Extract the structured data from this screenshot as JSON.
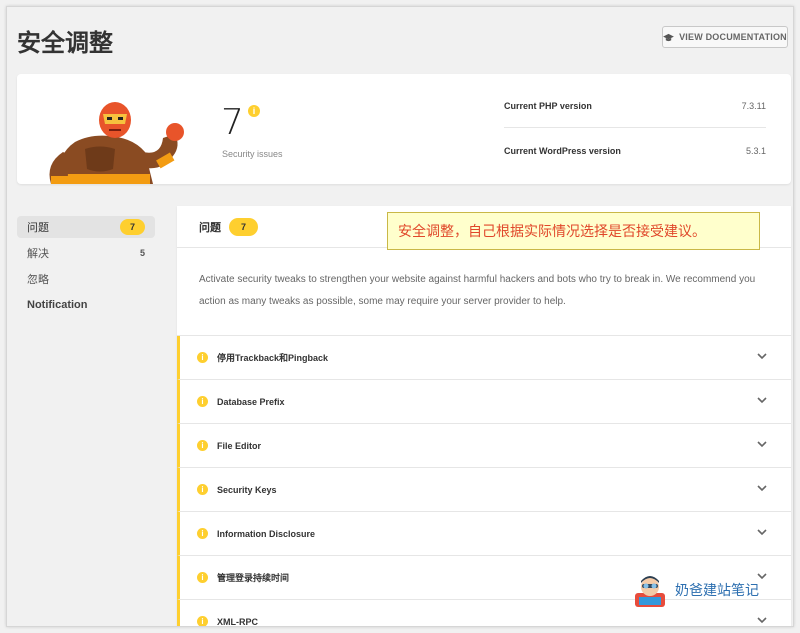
{
  "page": {
    "title": "安全调整",
    "doc_button": "VIEW DOCUMENTATION"
  },
  "summary": {
    "issue_count": "7",
    "issue_label": "Security issues",
    "php_label": "Current PHP version",
    "php_value": "7.3.11",
    "wp_label": "Current WordPress version",
    "wp_value": "5.3.1"
  },
  "sidenav": {
    "items": [
      {
        "label": "问题",
        "count": "7"
      },
      {
        "label": "解决",
        "count": "5"
      },
      {
        "label": "忽略",
        "count": ""
      },
      {
        "label": "Notification",
        "count": ""
      }
    ]
  },
  "panel": {
    "title": "问题",
    "count": "7",
    "description": "Activate security tweaks to strengthen your website against harmful hackers and bots who try to break in. We recommend you action as many tweaks as possible, some may require your server provider to help.",
    "issues": [
      {
        "name": "停用Trackback和Pingback"
      },
      {
        "name": "Database Prefix"
      },
      {
        "name": "File Editor"
      },
      {
        "name": "Security Keys"
      },
      {
        "name": "Information Disclosure"
      },
      {
        "name": "管理登录持续时间"
      },
      {
        "name": "XML-RPC"
      }
    ]
  },
  "callout": {
    "text": "安全调整，自己根据实际情况选择是否接受建议。"
  },
  "watermark": {
    "text": "奶爸建站笔记"
  },
  "colors": {
    "accent": "#fecf2f",
    "callout_bg": "#ffffcc",
    "callout_text": "#e0472a",
    "watermark_text": "#2d6fb0"
  },
  "icons": {
    "doc": "graduation-cap-icon",
    "warning": "warning-icon",
    "chevron": "chevron-down-icon",
    "hero": "superhero-illustration"
  }
}
